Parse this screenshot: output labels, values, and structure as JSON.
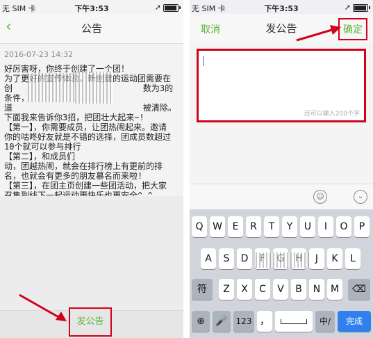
{
  "left": {
    "status": {
      "carrier": "无 SIM 卡",
      "time": "下午3:53"
    },
    "nav": {
      "title": "公告"
    },
    "date": "2016-07-23 14:32",
    "notice": "好厉害呀，你终于创建了一个团！\n为了更好的宣传体验，新创建的运动团需要在\n创                          数为3的条件，\n道                          被清除。\n下面我来告诉你3招，把团壮大起来~!\n【第一】，你需要成员，让团热闹起来。邀请\n你的咕咚好友就是不错的选择，团成员数超过\n10个就可以参与排行\n【第二】，和成员们\n动，团越热闹，就会在排行榜上有更前的排\n名，也就会有更多的朋友慕名而来啦!\n【第三】，在团主页创建一些团活动，把大家\n召集到线下一起运动更快乐也更安全^_^",
    "post_button": "发公告"
  },
  "right": {
    "status": {
      "carrier": "无 SIM 卡",
      "time": "下午3:53"
    },
    "nav": {
      "cancel": "取消",
      "title": "发公告",
      "confirm": "确定"
    },
    "editor": {
      "value": "",
      "hint": "还可以输入200个字"
    },
    "keyboard": {
      "row1": [
        "Q",
        "W",
        "E",
        "R",
        "T",
        "Y",
        "U",
        "I",
        "O",
        "P"
      ],
      "row2": [
        "A",
        "S",
        "D",
        "F",
        "G",
        "H",
        "J",
        "K",
        "L"
      ],
      "row3": [
        "Z",
        "X",
        "C",
        "V",
        "B",
        "N",
        "M"
      ],
      "symbol": "符",
      "num": "123",
      "comma": "，",
      "lang": "中/",
      "done": "完成"
    }
  },
  "colors": {
    "accent": "#5fb43c",
    "highlight": "#d0021b"
  }
}
